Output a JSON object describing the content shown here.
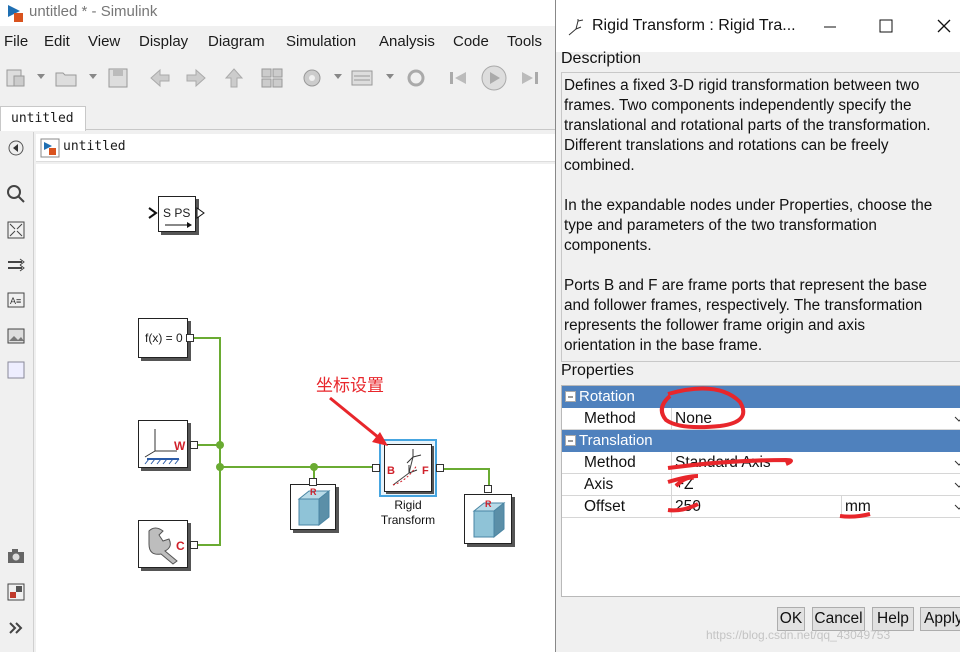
{
  "window": {
    "title": "untitled * - Simulink"
  },
  "menu": [
    "File",
    "Edit",
    "View",
    "Display",
    "Diagram",
    "Simulation",
    "Analysis",
    "Code",
    "Tools"
  ],
  "tab": {
    "label": "untitled"
  },
  "address": {
    "label": "untitled"
  },
  "blocks": {
    "sps": {
      "text": "S PS"
    },
    "solver": {
      "text": "f(x) = 0"
    },
    "world": {
      "port": "W"
    },
    "config": {
      "port": "C"
    },
    "rigid": {
      "port_b": "B",
      "port_f": "F",
      "label_line1": "Rigid",
      "label_line2": "Transform"
    }
  },
  "annotation": {
    "text": "坐标设置",
    "color": "#e8262b"
  },
  "dialog": {
    "title": "Rigid Transform : Rigid Tra...",
    "description_heading": "Description",
    "description": [
      "Defines a fixed 3-D rigid transformation between two",
      "frames. Two components independently specify the",
      "translational and rotational parts of the transformation.",
      "Different translations and rotations can be freely",
      "combined.",
      "",
      "In the expandable nodes under Properties, choose the",
      "type and parameters of the two transformation",
      "components.",
      "",
      "Ports B and F are frame ports that represent the base",
      "and follower frames, respectively. The transformation",
      "represents the follower frame origin and axis",
      "orientation in the base frame."
    ],
    "properties_heading": "Properties",
    "rotation": {
      "group": "Rotation",
      "method_label": "Method",
      "method_value": "None"
    },
    "translation": {
      "group": "Translation",
      "method_label": "Method",
      "method_value": "Standard Axis",
      "axis_label": "Axis",
      "axis_value": "+Z",
      "offset_label": "Offset",
      "offset_value": "250",
      "offset_unit": "mm"
    },
    "buttons": {
      "ok": "OK",
      "cancel": "Cancel",
      "help": "Help",
      "apply": "Apply"
    },
    "watermark": "https://blog.csdn.net/qq_43049753"
  },
  "colors": {
    "accent": "#4f81bd",
    "wire": "#6aab32",
    "markup": "#e8262b"
  }
}
